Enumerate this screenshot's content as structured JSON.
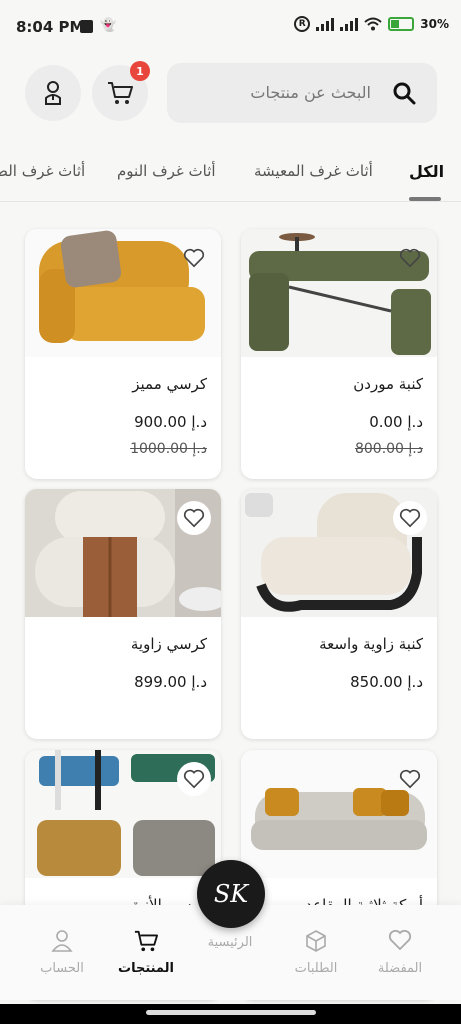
{
  "status_bar": {
    "time": "8:04 PM",
    "battery": "30%"
  },
  "header": {
    "search_placeholder": "البحث عن منتجات",
    "cart_count": "1"
  },
  "tabs": [
    {
      "label": "الكل",
      "active": true
    },
    {
      "label": "أثاث غرف المعيشة"
    },
    {
      "label": "أثاث غرف النوم"
    },
    {
      "label": "أثاث غرف الط"
    }
  ],
  "products": [
    {
      "name": "كنبة موردن",
      "price": "د.إ 0.00",
      "old_price": "د.إ 800.00"
    },
    {
      "name": "كرسي مميز",
      "price": "د.إ 900.00",
      "old_price": "د.إ 1000.00"
    },
    {
      "name": "كنبة زاوية واسعة",
      "price": "د.إ 850.00"
    },
    {
      "name": "كرسي زاوية",
      "price": "د.إ 899.00"
    },
    {
      "name": "أريكة ثلاثية المقاعد",
      "price": ""
    },
    {
      "name": "كرسي الأنيق",
      "price": ""
    }
  ],
  "bottom_nav": {
    "favorites": "المفضلة",
    "orders": "الطلبات",
    "home": "الرئيسية",
    "products": "المنتجات",
    "account": "الحساب",
    "fab_logo": "SK"
  },
  "colors": {
    "badge": "#e8453c",
    "accent": "#1a1a1a"
  }
}
